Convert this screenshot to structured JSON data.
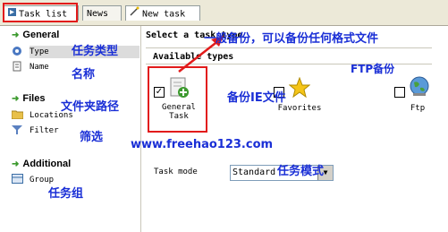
{
  "tabs": [
    {
      "label": "Task list"
    },
    {
      "label": "News"
    },
    {
      "label": "New task"
    }
  ],
  "sidebar": {
    "general": {
      "heading": "General",
      "items": [
        {
          "label": "Type"
        },
        {
          "label": "Name"
        }
      ]
    },
    "files": {
      "heading": "Files",
      "items": [
        {
          "label": "Locations"
        },
        {
          "label": "Filter"
        }
      ]
    },
    "additional": {
      "heading": "Additional",
      "items": [
        {
          "label": "Group"
        }
      ]
    }
  },
  "main": {
    "select_title": "Select a task type",
    "available_types": "Available types",
    "types": [
      {
        "label_line1": "General",
        "label_line2": "Task",
        "checked": true
      },
      {
        "label_line1": "Favorites",
        "label_line2": "",
        "checked": false
      },
      {
        "label_line1": "Ftp",
        "label_line2": "",
        "checked": false
      }
    ],
    "task_mode_label": "Task mode",
    "task_mode_value": "Standard"
  },
  "annotations": {
    "type_zh": "任务类型",
    "name_zh": "名称",
    "locations_zh": "文件夹路径",
    "filter_zh": "筛选",
    "group_zh": "任务组",
    "general_task_zh": "一般备份，可以备份任何格式文件",
    "favorites_zh": "备份IE文件",
    "ftp_zh": "FTP备份",
    "task_mode_zh": "任务模式",
    "website": "www.freehao123.com"
  },
  "colors": {
    "annotation_text": "#1a2fd6",
    "annotation_red": "#e21b1b",
    "accent_green": "#3c9a2e"
  }
}
